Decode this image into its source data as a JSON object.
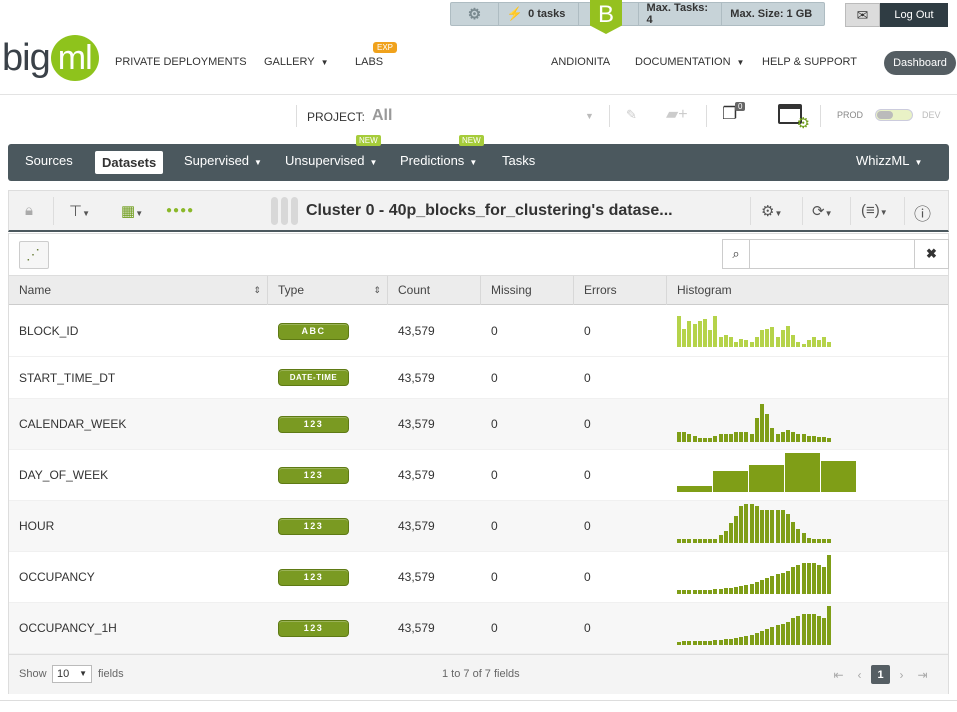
{
  "status_bar": {
    "tasks": "0 tasks",
    "badge_letter": "B",
    "max_tasks": "Max. Tasks: 4",
    "max_size": "Max. Size: 1 GB"
  },
  "header": {
    "logout": "Log Out",
    "logo_big": "big",
    "logo_ml": "ml",
    "nav": {
      "private_deployments": "PRIVATE DEPLOYMENTS",
      "gallery": "GALLERY",
      "labs": "LABS",
      "labs_badge": "EXP",
      "user": "ANDIONITA",
      "documentation": "DOCUMENTATION",
      "help": "HELP & SUPPORT",
      "dashboard": "Dashboard"
    }
  },
  "project": {
    "label": "PROJECT:",
    "value": "All",
    "folders_count": "0",
    "prod": "PROD",
    "dev": "DEV"
  },
  "tabs": {
    "sources": "Sources",
    "datasets": "Datasets",
    "supervised": "Supervised",
    "unsupervised": "Unsupervised",
    "predictions": "Predictions",
    "tasks": "Tasks",
    "whizzml": "WhizzML",
    "new_badge": "NEW"
  },
  "dataset": {
    "title": "Cluster 0 - 40p_blocks_for_clustering's datase..."
  },
  "table": {
    "headers": [
      "Name",
      "Type",
      "Count",
      "Missing",
      "Errors",
      "Histogram"
    ],
    "rows": [
      {
        "name": "BLOCK_ID",
        "type": "ABC",
        "count": "43,579",
        "missing": "0",
        "errors": "0"
      },
      {
        "name": "START_TIME_DT",
        "type": "DATE-TIME",
        "count": "43,579",
        "missing": "0",
        "errors": "0"
      },
      {
        "name": "CALENDAR_WEEK",
        "type": "123",
        "count": "43,579",
        "missing": "0",
        "errors": "0"
      },
      {
        "name": "DAY_OF_WEEK",
        "type": "123",
        "count": "43,579",
        "missing": "0",
        "errors": "0"
      },
      {
        "name": "HOUR",
        "type": "123",
        "count": "43,579",
        "missing": "0",
        "errors": "0"
      },
      {
        "name": "OCCUPANCY",
        "type": "123",
        "count": "43,579",
        "missing": "0",
        "errors": "0"
      },
      {
        "name": "OCCUPANCY_1H",
        "type": "123",
        "count": "43,579",
        "missing": "0",
        "errors": "0"
      }
    ]
  },
  "footer": {
    "show": "Show",
    "page_size": "10",
    "fields": "fields",
    "info": "1 to 7 of 7 fields",
    "current_page": "1"
  },
  "colors": {
    "accent_green": "#8ec31c",
    "hist_light": "#b5d34a",
    "hist_dark": "#7f9e17",
    "tabbar": "#4b585e"
  }
}
